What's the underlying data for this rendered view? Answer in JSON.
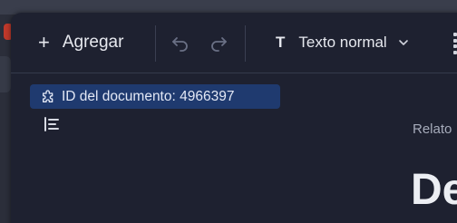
{
  "toolbar": {
    "add_label": "Agregar",
    "text_style": "Texto normal"
  },
  "document": {
    "id_label": "ID del documento: 4966397",
    "breadcrumb": "Relato",
    "title": "De"
  },
  "colors": {
    "panel_bg": "#1e2130",
    "doc_id_bg": "#1f3a6f",
    "page_bg": "#2b2e3a"
  },
  "icons": [
    "plus-icon",
    "undo-icon",
    "redo-icon",
    "text-style-icon",
    "chevron-down-icon",
    "more-icon",
    "puzzle-icon",
    "outline-icon"
  ]
}
